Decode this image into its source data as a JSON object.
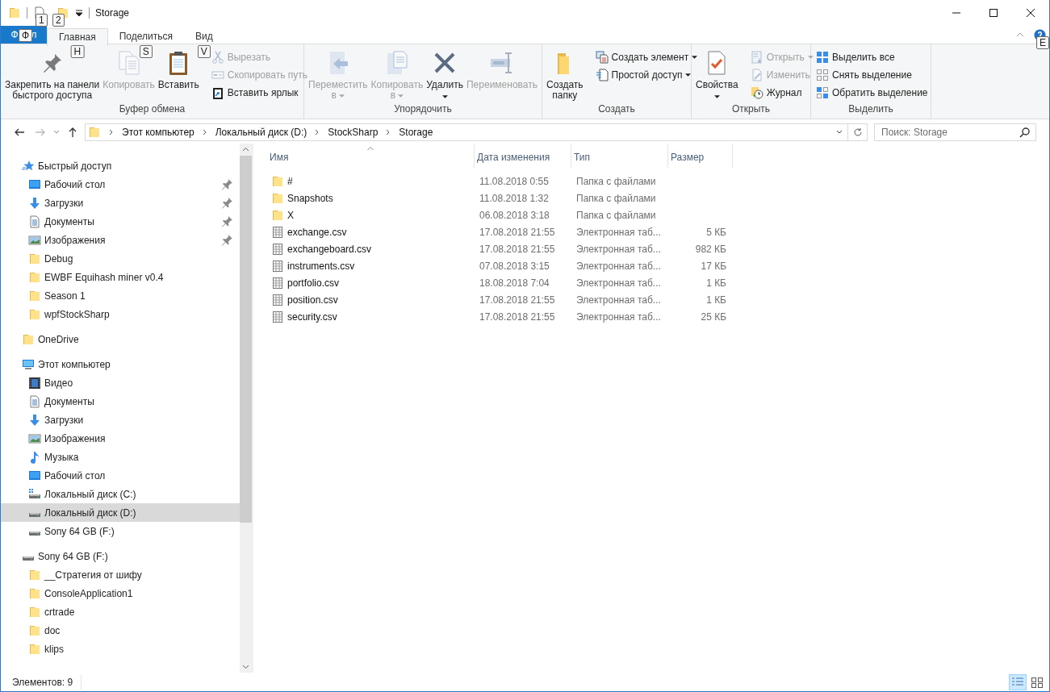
{
  "window": {
    "title": "Storage",
    "qat_keytips": [
      "1",
      "2"
    ]
  },
  "file_tab": {
    "label_start": "Ф",
    "keytip": "Ф",
    "label_end": "л"
  },
  "ribbon_tabs": [
    {
      "label": "Главная",
      "selected": true,
      "keytip": "H"
    },
    {
      "label": "Поделиться",
      "selected": false,
      "keytip": "S"
    },
    {
      "label": "Вид",
      "selected": false,
      "keytip": "V"
    }
  ],
  "help_keytip": "E",
  "ribbon_groups": [
    {
      "label": "Буфер обмена",
      "large": [
        {
          "kind": "pin",
          "lines": [
            "Закрепить на панели",
            "быстрого доступа"
          ],
          "disabled": false,
          "dropdown": false
        },
        {
          "kind": "copy",
          "lines": [
            "Копировать"
          ],
          "disabled": true,
          "dropdown": false
        },
        {
          "kind": "paste",
          "lines": [
            "Вставить"
          ],
          "disabled": false,
          "dropdown": false
        }
      ],
      "small": [
        {
          "kind": "cut",
          "label": "Вырезать",
          "disabled": true,
          "dropdown": false
        },
        {
          "kind": "copypath",
          "label": "Скопировать путь",
          "disabled": true,
          "dropdown": false
        },
        {
          "kind": "shortcut",
          "label": "Вставить ярлык",
          "disabled": false,
          "dropdown": false
        }
      ]
    },
    {
      "label": "Упорядочить",
      "large": [
        {
          "kind": "move",
          "lines": [
            "Переместить",
            "в"
          ],
          "disabled": true,
          "dropdown": true
        },
        {
          "kind": "copyto",
          "lines": [
            "Копировать",
            "в"
          ],
          "disabled": true,
          "dropdown": true
        },
        {
          "kind": "delete",
          "lines": [
            "Удалить"
          ],
          "disabled": false,
          "dropdown": true
        },
        {
          "kind": "rename",
          "lines": [
            "Переименовать"
          ],
          "disabled": true,
          "dropdown": false
        }
      ]
    },
    {
      "label": "Создать",
      "large": [
        {
          "kind": "newfolder",
          "lines": [
            "Создать",
            "папку"
          ],
          "disabled": false,
          "dropdown": false
        }
      ],
      "small": [
        {
          "kind": "newitem",
          "label": "Создать элемент",
          "disabled": false,
          "dropdown": true
        },
        {
          "kind": "easyaccess",
          "label": "Простой доступ",
          "disabled": false,
          "dropdown": true
        }
      ]
    },
    {
      "label": "Открыть",
      "large": [
        {
          "kind": "properties",
          "lines": [
            "Свойства"
          ],
          "disabled": false,
          "dropdown": true
        }
      ],
      "small": [
        {
          "kind": "open",
          "label": "Открыть",
          "disabled": true,
          "dropdown": true
        },
        {
          "kind": "edit",
          "label": "Изменить",
          "disabled": true,
          "dropdown": false
        },
        {
          "kind": "history",
          "label": "Журнал",
          "disabled": false,
          "dropdown": false
        }
      ]
    },
    {
      "label": "Выделить",
      "small": [
        {
          "kind": "selectall",
          "label": "Выделить все",
          "disabled": false,
          "dropdown": false
        },
        {
          "kind": "selectnone",
          "label": "Снять выделение",
          "disabled": false,
          "dropdown": false
        },
        {
          "kind": "invert",
          "label": "Обратить выделение",
          "disabled": false,
          "dropdown": false
        }
      ]
    }
  ],
  "navigation": {
    "back": {
      "disabled": false
    },
    "forward": {
      "disabled": true
    }
  },
  "address": [
    "Этот компьютер",
    "Локальный диск (D:)",
    "StockSharp",
    "Storage"
  ],
  "search": {
    "placeholder": "Поиск: Storage"
  },
  "sidebar": [
    {
      "label": "Быстрый доступ",
      "kind": "star",
      "selected": false,
      "children": [
        {
          "label": "Рабочий стол",
          "kind": "desktop",
          "pinned": true,
          "selected": false
        },
        {
          "label": "Загрузки",
          "kind": "downloads",
          "pinned": true,
          "selected": false
        },
        {
          "label": "Документы",
          "kind": "documents",
          "pinned": true,
          "selected": false
        },
        {
          "label": "Изображения",
          "kind": "pictures",
          "pinned": true,
          "selected": false
        },
        {
          "label": "Debug",
          "kind": "folder",
          "pinned": false,
          "selected": false
        },
        {
          "label": "EWBF Equihash miner v0.4",
          "kind": "folder",
          "pinned": false,
          "selected": false
        },
        {
          "label": "Season 1",
          "kind": "folder",
          "pinned": false,
          "selected": false
        },
        {
          "label": "wpfStockSharp",
          "kind": "folder",
          "pinned": false,
          "selected": false
        }
      ]
    },
    {
      "label": "OneDrive",
      "kind": "folder",
      "selected": false
    },
    {
      "label": "Этот компьютер",
      "kind": "computer",
      "selected": false,
      "children": [
        {
          "label": "Видео",
          "kind": "video",
          "selected": false
        },
        {
          "label": "Документы",
          "kind": "documents",
          "selected": false
        },
        {
          "label": "Загрузки",
          "kind": "downloads",
          "selected": false
        },
        {
          "label": "Изображения",
          "kind": "pictures",
          "selected": false
        },
        {
          "label": "Музыка",
          "kind": "music",
          "selected": false
        },
        {
          "label": "Рабочий стол",
          "kind": "desktop",
          "selected": false
        },
        {
          "label": "Локальный диск (C:)",
          "kind": "systemdrive",
          "selected": false
        },
        {
          "label": "Локальный диск (D:)",
          "kind": "drive",
          "selected": true
        },
        {
          "label": "Sony 64 GB (F:)",
          "kind": "drive",
          "selected": false
        }
      ]
    },
    {
      "label": "Sony 64 GB (F:)",
      "kind": "drive",
      "selected": false,
      "children": [
        {
          "label": "__Стратегия от шифу",
          "kind": "folder",
          "selected": false
        },
        {
          "label": "ConsoleApplication1",
          "kind": "folder",
          "selected": false
        },
        {
          "label": "crtrade",
          "kind": "folder",
          "selected": false
        },
        {
          "label": "doc",
          "kind": "folder",
          "selected": false
        },
        {
          "label": "klips",
          "kind": "folder",
          "selected": false
        }
      ]
    }
  ],
  "columns": [
    {
      "label": "Имя",
      "sorted": true
    },
    {
      "label": "Дата изменения",
      "sorted": false
    },
    {
      "label": "Тип",
      "sorted": false
    },
    {
      "label": "Размер",
      "sorted": false
    }
  ],
  "files": [
    {
      "kind": "folder",
      "name": "#",
      "date": "11.08.2018 0:55",
      "type": "Папка с файлами"
    },
    {
      "kind": "folder",
      "name": "Snapshots",
      "date": "11.08.2018 1:32",
      "type": "Папка с файлами"
    },
    {
      "kind": "folder",
      "name": "X",
      "date": "06.08.2018 3:18",
      "type": "Папка с файлами"
    },
    {
      "kind": "sheet",
      "name": "exchange.csv",
      "date": "17.08.2018 21:55",
      "type": "Электронная таб...",
      "size": "5 КБ"
    },
    {
      "kind": "sheet",
      "name": "exchangeboard.csv",
      "date": "17.08.2018 21:55",
      "type": "Электронная таб...",
      "size": "982 КБ"
    },
    {
      "kind": "sheet",
      "name": "instruments.csv",
      "date": "07.08.2018 3:15",
      "type": "Электронная таб...",
      "size": "17 КБ"
    },
    {
      "kind": "sheet",
      "name": "portfolio.csv",
      "date": "18.08.2018 7:04",
      "type": "Электронная таб...",
      "size": "1 КБ"
    },
    {
      "kind": "sheet",
      "name": "position.csv",
      "date": "17.08.2018 21:55",
      "type": "Электронная таб...",
      "size": "1 КБ"
    },
    {
      "kind": "sheet",
      "name": "security.csv",
      "date": "17.08.2018 21:55",
      "type": "Электронная таб...",
      "size": "25 КБ"
    }
  ],
  "status": "Элементов: 9",
  "view_buttons": [
    {
      "kind": "details",
      "selected": true
    },
    {
      "kind": "tiles",
      "selected": false
    }
  ]
}
